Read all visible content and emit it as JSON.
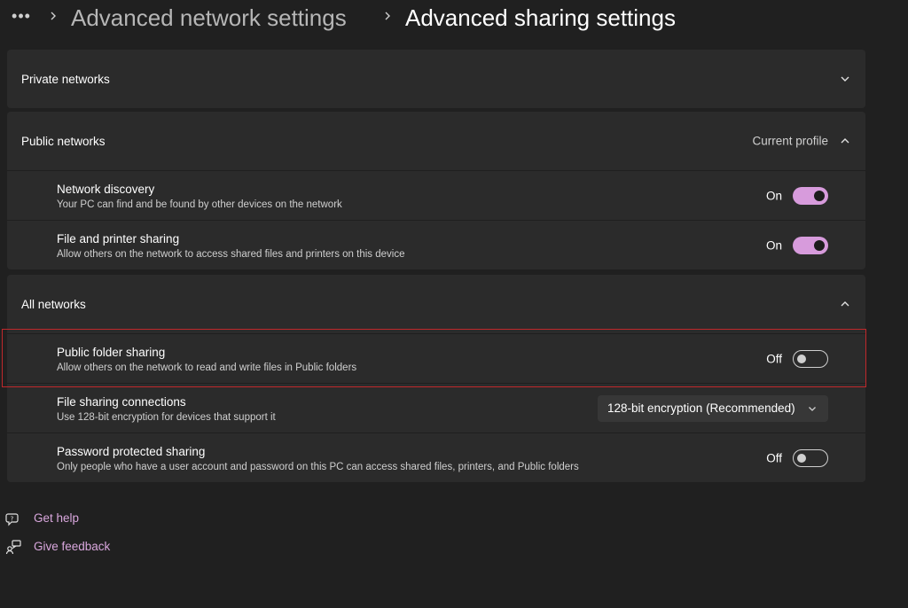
{
  "breadcrumb": {
    "more_glyph": "•••",
    "parent": "Advanced network settings",
    "current": "Advanced sharing settings"
  },
  "private_networks": {
    "label": "Private networks",
    "expanded": false
  },
  "public_networks": {
    "label": "Public networks",
    "profile_tag": "Current profile",
    "expanded": true,
    "items": [
      {
        "title": "Network discovery",
        "description": "Your PC can find and be found by other devices on the network",
        "state_label": "On",
        "enabled": true
      },
      {
        "title": "File and printer sharing",
        "description": "Allow others on the network to access shared files and printers on this device",
        "state_label": "On",
        "enabled": true
      }
    ]
  },
  "all_networks": {
    "label": "All networks",
    "expanded": true,
    "public_folder_sharing": {
      "title": "Public folder sharing",
      "description": "Allow others on the network to read and write files in Public folders",
      "state_label": "Off",
      "enabled": false
    },
    "file_sharing_connections": {
      "title": "File sharing connections",
      "description": "Use 128-bit encryption for devices that support it",
      "selected": "128-bit encryption (Recommended)"
    },
    "password_protected_sharing": {
      "title": "Password protected sharing",
      "description": "Only people who have a user account and password on this PC can access shared files, printers, and Public folders",
      "state_label": "Off",
      "enabled": false
    }
  },
  "footer": {
    "get_help": "Get help",
    "give_feedback": "Give feedback"
  },
  "colors": {
    "background": "#202020",
    "card": "#2b2b2b",
    "accent": "#d79bdc",
    "link": "#d9a7dd",
    "highlight_border": "#c0282b"
  }
}
